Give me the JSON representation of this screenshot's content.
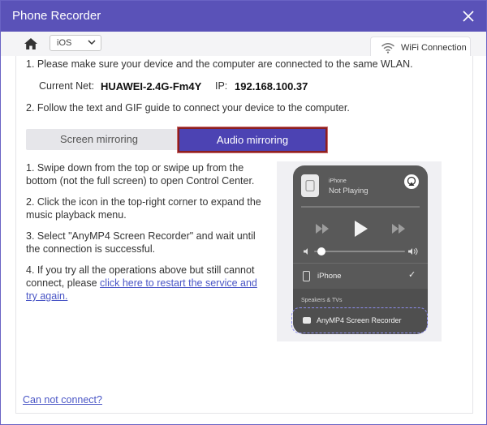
{
  "window": {
    "title": "Phone Recorder"
  },
  "toolbar": {
    "os_select_value": "iOS",
    "wifi_tab_label": "WiFi Connection"
  },
  "instructions": {
    "step1": "1. Please make sure your device and the computer are connected to the same WLAN.",
    "current_net_label": "Current Net:",
    "current_net_value": "HUAWEI-2.4G-Fm4Y",
    "ip_label": "IP:",
    "ip_value": "192.168.100.37",
    "step2": "2. Follow the text and GIF guide to connect your device to the computer."
  },
  "mode_tabs": {
    "screen": "Screen mirroring",
    "audio": "Audio mirroring",
    "selected": "audio"
  },
  "audio_steps": {
    "s1": "1. Swipe down from the top or swipe up from the bottom (not the full screen) to open Control Center.",
    "s2": "2. Click the icon in the top-right corner to expand the music playback menu.",
    "s3": "3. Select \"AnyMP4 Screen Recorder\" and wait until the connection is successful.",
    "s4_prefix": "4. If you try all the operations above but still cannot connect, please ",
    "s4_link": "click here to restart the service and try again."
  },
  "phone_guide": {
    "device_small": "iPhone",
    "now_playing": "Not Playing",
    "device_row": "iPhone",
    "speakers_header": "Speakers & TVs",
    "target_row": "AnyMP4 Screen Recorder"
  },
  "footer": {
    "cannot_connect": "Can not connect?"
  },
  "colors": {
    "accent": "#5a52b8",
    "selected_tab": "#4c43b3",
    "tab_border": "#8c1f1f",
    "link": "#4a56c6"
  },
  "icons": [
    "home-icon",
    "close-icon",
    "chevron-down-icon",
    "wifi-icon",
    "airplay-icon",
    "play-icon",
    "rewind-icon",
    "forward-icon",
    "volume-low-icon",
    "volume-high-icon",
    "phone-icon",
    "checkmark-icon",
    "appletv-icon"
  ]
}
